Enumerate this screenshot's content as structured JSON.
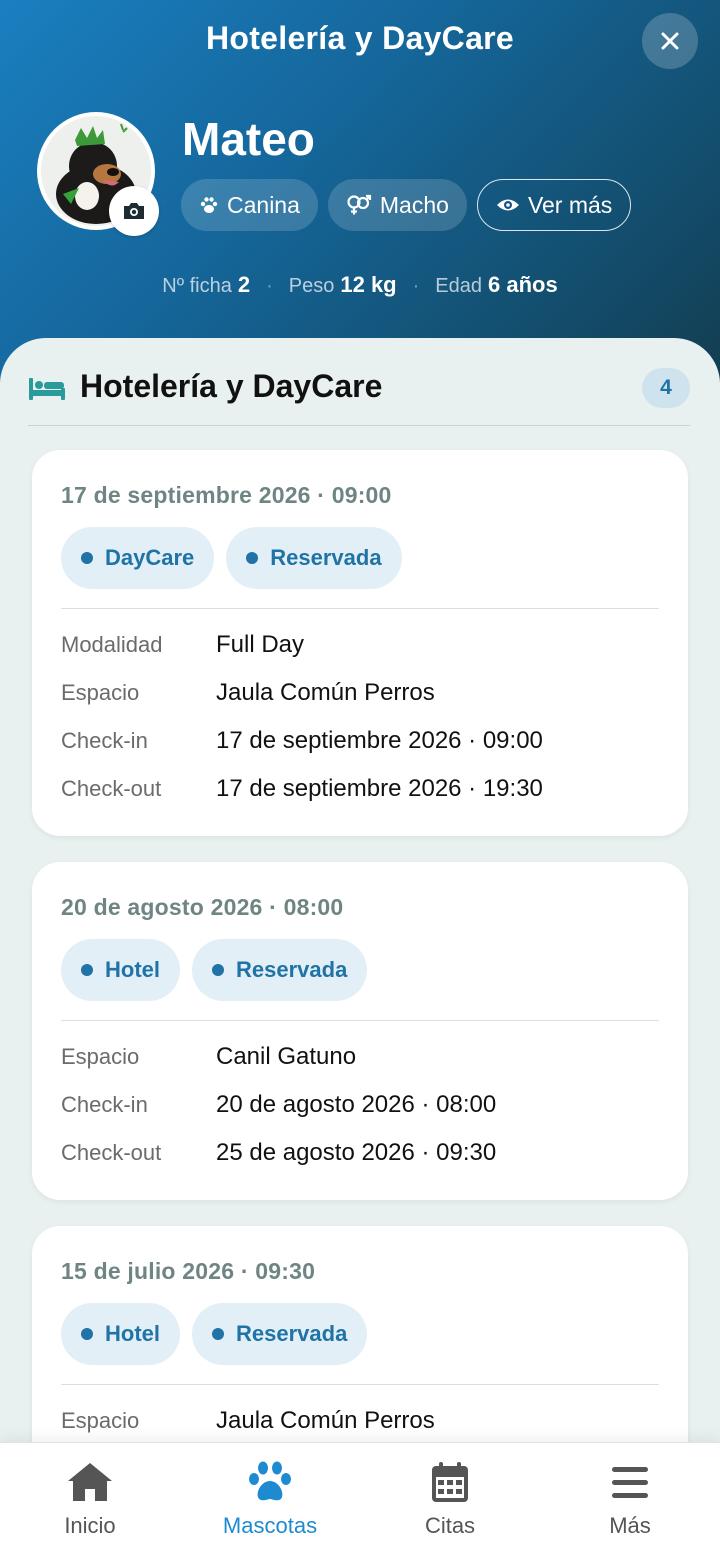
{
  "header": {
    "title": "Hotelería y DayCare",
    "close_icon": "close-icon"
  },
  "pet": {
    "name": "Mateo",
    "chips": [
      {
        "icon": "paw-icon",
        "label": "Canina"
      },
      {
        "icon": "gender-icon",
        "label": "Macho"
      },
      {
        "icon": "eye-icon",
        "label": "Ver más"
      }
    ],
    "stats": {
      "ficha_label": "Nº ficha",
      "ficha_value": "2",
      "peso_label": "Peso",
      "peso_value": "12 kg",
      "edad_label": "Edad",
      "edad_value": "6 años"
    }
  },
  "section": {
    "icon": "bed-icon",
    "title": "Hotelería y DayCare",
    "count": "4"
  },
  "cards": [
    {
      "date": "17 de septiembre 2026 · 09:00",
      "badges": [
        "DayCare",
        "Reservada"
      ],
      "rows": [
        {
          "label": "Modalidad",
          "value": "Full Day"
        },
        {
          "label": "Espacio",
          "value": "Jaula Común Perros"
        },
        {
          "label": "Check-in",
          "value": "17 de septiembre 2026 · 09:00"
        },
        {
          "label": "Check-out",
          "value": "17 de septiembre 2026 · 19:30"
        }
      ]
    },
    {
      "date": "20 de agosto 2026 · 08:00",
      "badges": [
        "Hotel",
        "Reservada"
      ],
      "rows": [
        {
          "label": "Espacio",
          "value": "Canil Gatuno"
        },
        {
          "label": "Check-in",
          "value": "20 de agosto 2026 · 08:00"
        },
        {
          "label": "Check-out",
          "value": "25 de agosto 2026 · 09:30"
        }
      ]
    },
    {
      "date": "15 de julio 2026 · 09:30",
      "badges": [
        "Hotel",
        "Reservada"
      ],
      "rows": [
        {
          "label": "Espacio",
          "value": "Jaula Común Perros"
        }
      ]
    }
  ],
  "nav": {
    "items": [
      {
        "icon": "home-icon",
        "label": "Inicio"
      },
      {
        "icon": "paw-icon",
        "label": "Mascotas"
      },
      {
        "icon": "calendar-icon",
        "label": "Citas"
      },
      {
        "icon": "menu-icon",
        "label": "Más"
      }
    ],
    "active_color": "#1e8bd0"
  },
  "colors": {
    "accent": "#1f73a6",
    "header_start": "#1a7fc0",
    "header_end": "#133b4c",
    "section_icon": "#2a9a9a"
  }
}
